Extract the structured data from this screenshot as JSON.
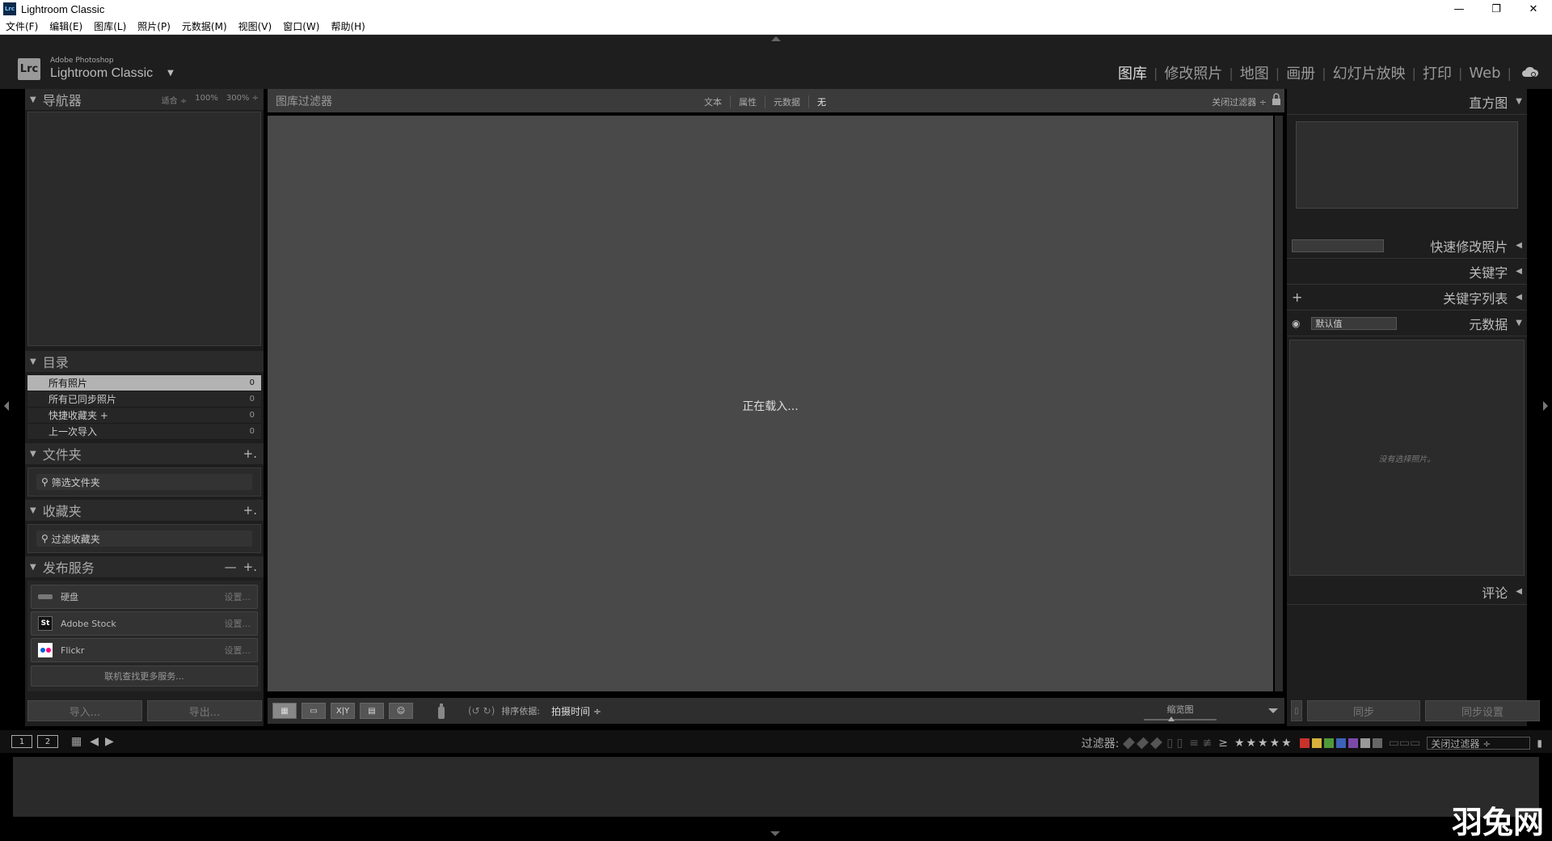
{
  "window": {
    "app_icon_text": "Lrc",
    "title": "Lightroom Classic",
    "controls": [
      "—",
      "❐",
      "✕"
    ]
  },
  "menu": [
    "文件(F)",
    "编辑(E)",
    "图库(L)",
    "照片(P)",
    "元数据(M)",
    "视图(V)",
    "窗口(W)",
    "帮助(H)"
  ],
  "identity": {
    "badge": "Lrc",
    "line1": "Adobe Photoshop",
    "line2": "Lightroom Classic",
    "arrow": "▼"
  },
  "modules": [
    "图库",
    "修改照片",
    "地图",
    "画册",
    "幻灯片放映",
    "打印",
    "Web"
  ],
  "left": {
    "navigator": {
      "title": "导航器",
      "opts": [
        "适合 ÷",
        "100%",
        "300% ÷"
      ]
    },
    "catalog": {
      "title": "目录",
      "rows": [
        {
          "name": "所有照片",
          "count": "0"
        },
        {
          "name": "所有已同步照片",
          "count": "0"
        },
        {
          "name": "快捷收藏夹 +",
          "count": "0"
        },
        {
          "name": "上一次导入",
          "count": "0"
        }
      ]
    },
    "folders": {
      "title": "文件夹",
      "plus": "+.",
      "filter": "筛选文件夹"
    },
    "collections": {
      "title": "收藏夹",
      "plus": "+.",
      "filter": "过滤收藏夹"
    },
    "publish": {
      "title": "发布服务",
      "minus": "—",
      "plus": "+.",
      "rows": [
        {
          "icon": "",
          "name": "硬盘",
          "set": "设置..."
        },
        {
          "icon": "St",
          "name": "Adobe Stock",
          "set": "设置..."
        },
        {
          "icon": "●●",
          "name": "Flickr",
          "set": "设置..."
        }
      ],
      "find_more": "联机查找更多服务..."
    },
    "import_label": "导入...",
    "export_label": "导出..."
  },
  "center": {
    "filter_label": "图库过滤器",
    "filter_opts": [
      "文本",
      "属性",
      "元数据",
      "无"
    ],
    "filter_close": "关闭过滤器 ÷",
    "loading": "正在载入...",
    "sort_label": "排序依据:",
    "sort_value": "拍摄时间 ÷",
    "thumb_label": "缩览图",
    "rotate": "(↺ ↻)",
    "view_buttons": [
      "▦",
      "▭",
      "X|Y",
      "▤",
      "☺"
    ]
  },
  "right": {
    "histogram": "直方图",
    "quick_develop": "快速修改照片",
    "keywording": "关键字",
    "keyword_list": "关键字列表",
    "keyword_plus": "+",
    "metadata": "元数据",
    "metadata_preset": "默认值",
    "metadata_empty": "没有选择照片。",
    "comments": "评论",
    "sync_label": "同步",
    "sync_settings_label": "同步设置"
  },
  "filmbar": {
    "screens": [
      "1",
      "2"
    ],
    "filter_label": "过滤器:",
    "ge": "≥",
    "stars": "★★★★★",
    "filter_dropdown": "关闭过滤器 ÷",
    "colors": [
      "#c8322b",
      "#d6b23a",
      "#4f9a3a",
      "#3d62b8",
      "#7b4aa8",
      "#999999",
      "#666666"
    ]
  },
  "watermark": "羽兔网"
}
